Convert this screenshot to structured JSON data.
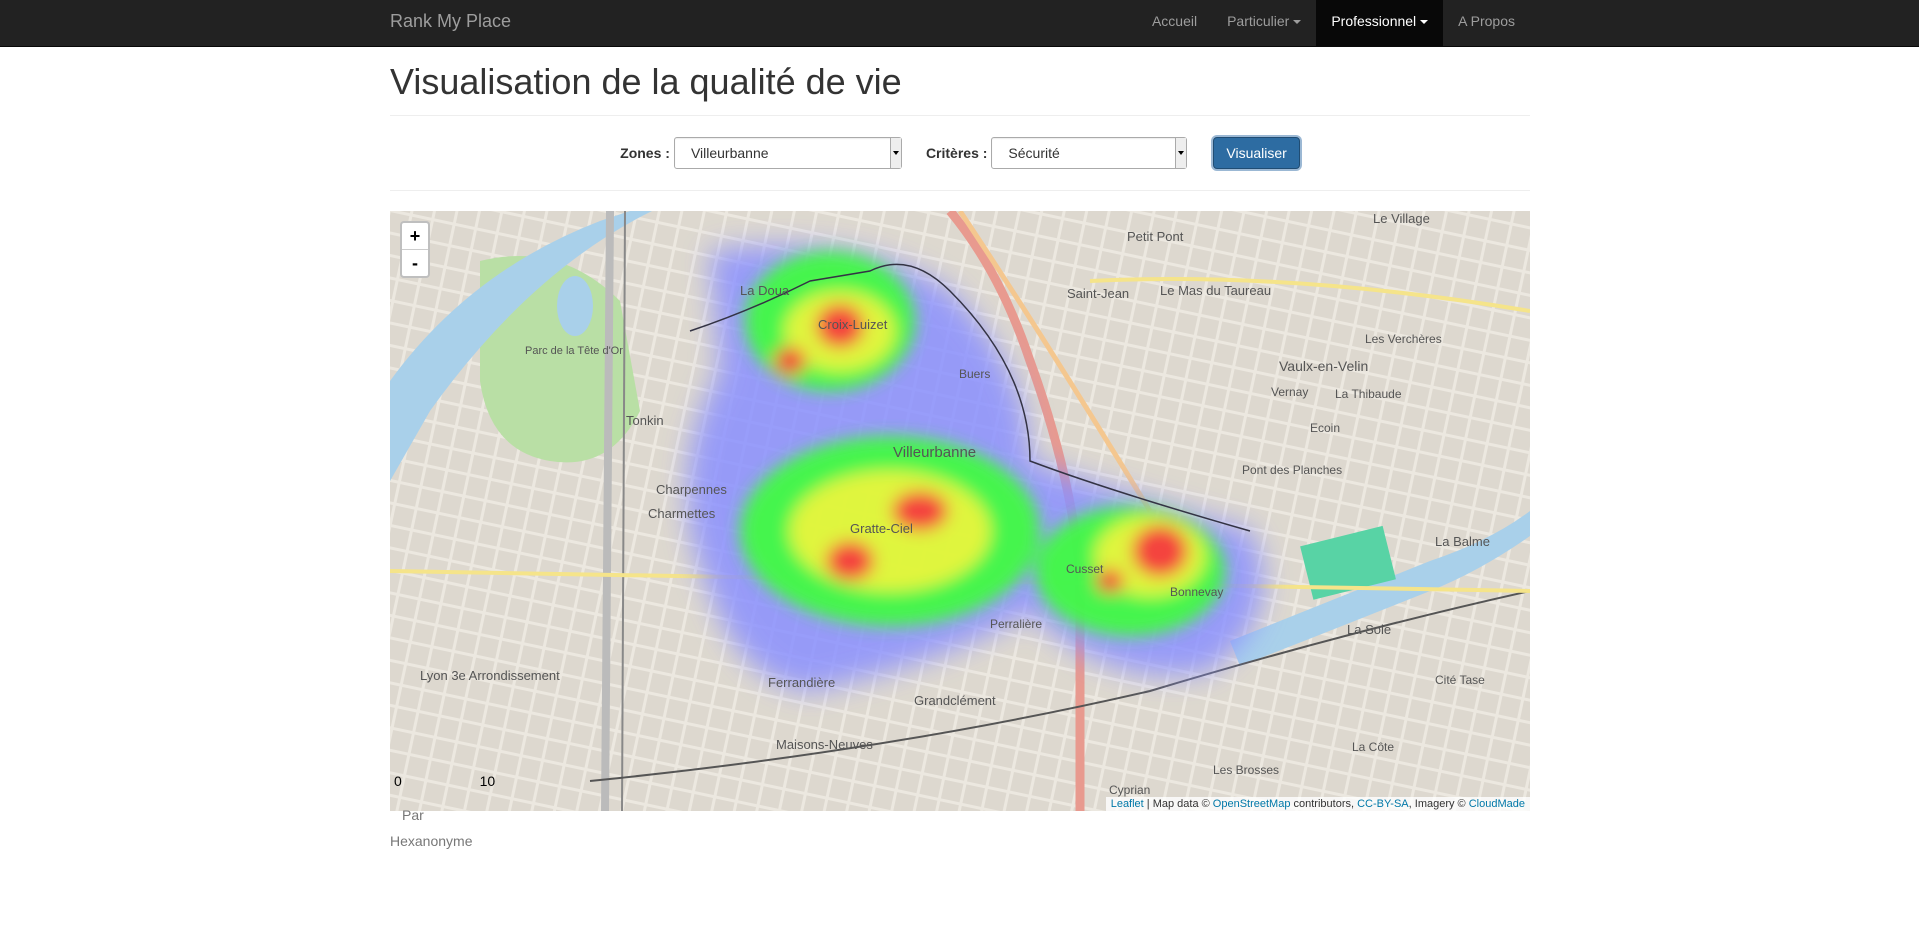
{
  "navbar": {
    "brand": "Rank My Place",
    "items": [
      {
        "label": "Accueil",
        "dropdown": false,
        "active": false
      },
      {
        "label": "Particulier",
        "dropdown": true,
        "active": false
      },
      {
        "label": "Professionnel",
        "dropdown": true,
        "active": true
      },
      {
        "label": "A Propos",
        "dropdown": false,
        "active": false
      }
    ]
  },
  "page": {
    "title": "Visualisation de la qualité de vie"
  },
  "form": {
    "zones_label": "Zones :",
    "zones_value": "Villeurbanne",
    "criteres_label": "Critères :",
    "criteres_value": "Sécurité",
    "submit_label": "Visualiser"
  },
  "map": {
    "zoom_in": "+",
    "zoom_out": "-",
    "scale_left": "0",
    "scale_right": "10",
    "attribution": {
      "leaflet": "Leaflet",
      "map_data_prefix": " | Map data © ",
      "osm": "OpenStreetMap",
      "contributors": " contributors, ",
      "license": "CC-BY-SA",
      "imagery_prefix": ", Imagery © ",
      "cloudmade": "CloudMade"
    },
    "places": [
      "La Doua",
      "Croix-Luizet",
      "Villeurbanne",
      "Tonkin",
      "Charpennes",
      "Charmettes",
      "Gratte-Ciel",
      "Cusset",
      "Bonnevay",
      "Perralière",
      "Ferrandière",
      "Grandclément",
      "Maisons-Neuves",
      "Saint-Jean",
      "Le Mas du Taureau",
      "Vaulx-en-Velin",
      "Petit Pont",
      "Le Village",
      "Les Verchères",
      "Vernay",
      "La Thibaude",
      "Ecoin",
      "Pont des Planches",
      "La Balme",
      "La Soie",
      "Cité Tase",
      "La Côte",
      "Les Brosses",
      "Cyprian",
      "Buers",
      "Parc de la Tête d'Or",
      "Lyon 3e Arrondissement"
    ],
    "heat_colors": [
      "#6a78ff",
      "#3dff3a",
      "#e8ff2a",
      "#ff3b2a"
    ]
  },
  "footer": {
    "par": "Par",
    "author": "Hexanonyme"
  }
}
